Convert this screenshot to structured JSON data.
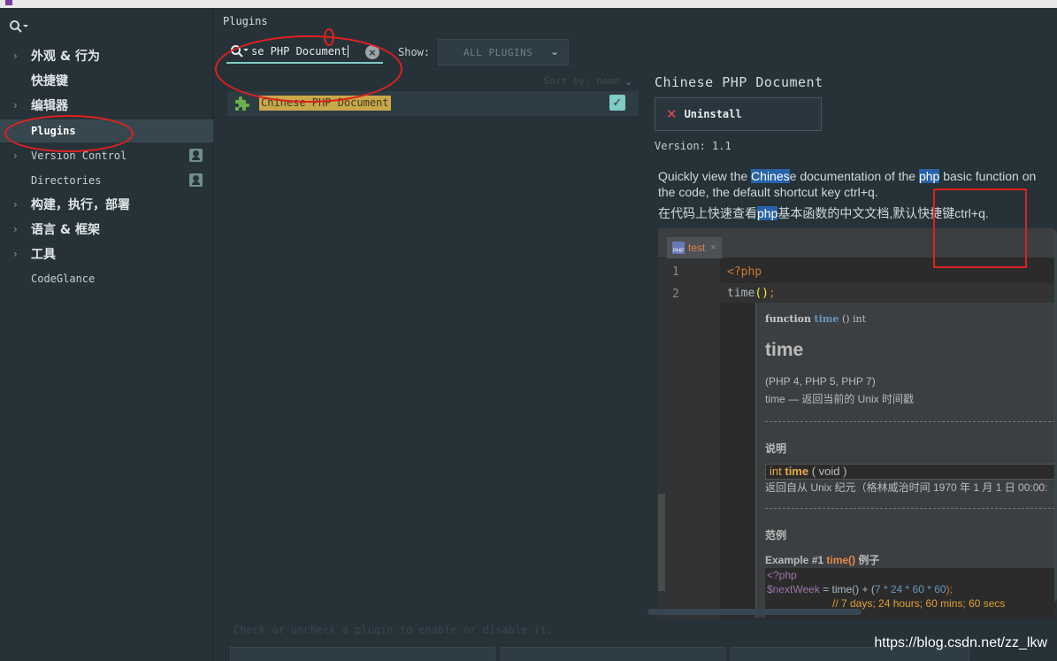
{
  "sidebar": {
    "search_icon": "search-icon",
    "items": [
      {
        "label": "外观 & 行为",
        "expandable": true
      },
      {
        "label": "快捷键",
        "expandable": false
      },
      {
        "label": "编辑器",
        "expandable": true
      },
      {
        "label": "Plugins",
        "expandable": false,
        "selected": true
      },
      {
        "label": "Version Control",
        "expandable": true
      },
      {
        "label": "Directories",
        "expandable": false
      },
      {
        "label": "构建，执行，部署",
        "expandable": true
      },
      {
        "label": "语言 & 框架",
        "expandable": true
      },
      {
        "label": "工具",
        "expandable": true
      },
      {
        "label": "CodeGlance",
        "expandable": false
      }
    ]
  },
  "header": {
    "title": "Plugins",
    "search_value": "se PHP Document",
    "show_label": "Show:",
    "show_value": "ALL PLUGINS",
    "sort_label": "Sort by: name"
  },
  "plugin_list": [
    {
      "name": "Chinese PHP Document",
      "checked": true
    }
  ],
  "details": {
    "name": "Chinese PHP Document",
    "uninstall_label": "Uninstall",
    "version": "Version: 1.1",
    "desc_en_a": "Quickly view the ",
    "desc_en_hl1": "Chines",
    "desc_en_b": "e documentation of the ",
    "desc_en_hl2": "php",
    "desc_en_c": " basic function on the code, the default shortcut key ctrl+q.",
    "desc_cn_a": "在代码上快速查看",
    "desc_cn_hl": "php",
    "desc_cn_b": "基本函数的中文文档,默认快捷键ctrl+q."
  },
  "screenshot": {
    "tab_label": "test",
    "tab_icon_text": "PHP",
    "tab_close": "×",
    "line1_num": "1",
    "line2_num": "2",
    "line1_code": "<?php",
    "line2_fn": "time",
    "line2_paren": "()",
    "line2_semi": ";",
    "popup": {
      "sig_function": "function",
      "sig_name": "time",
      "sig_rest": "() int",
      "title": "time",
      "versions": "(PHP 4, PHP 5, PHP 7)",
      "summary": "time — 返回当前的 Unix 时间戳",
      "sect_desc": "说明",
      "syn_type": "int",
      "syn_name": "time",
      "syn_rest": "( void )",
      "returns": "返回自从 Unix 纪元（格林威治时间 1970 年 1 月 1 日 00:00:",
      "sect_example": "范例",
      "example_label": "Example #1 ",
      "example_fn": "time()",
      "example_suffix": " 例子",
      "ex_line1": "<?php",
      "ex_var": "$nextWeek",
      "ex_eq": " = ",
      "ex_call": "time() + (",
      "ex_nums": "7 * 24 * 60 * 60",
      "ex_end": ");",
      "ex_comment": "// 7 days; 24 hours; 60 mins; 60 secs"
    }
  },
  "footer": {
    "hint": "Check or uncheck a plugin to enable or disable it."
  },
  "watermark": "https://blog.csdn.net/zz_lkw",
  "colors": {
    "background": "#263238",
    "accent": "#80cbc4",
    "highlight": "#c9a84a",
    "annotation_red": "#e02020"
  }
}
